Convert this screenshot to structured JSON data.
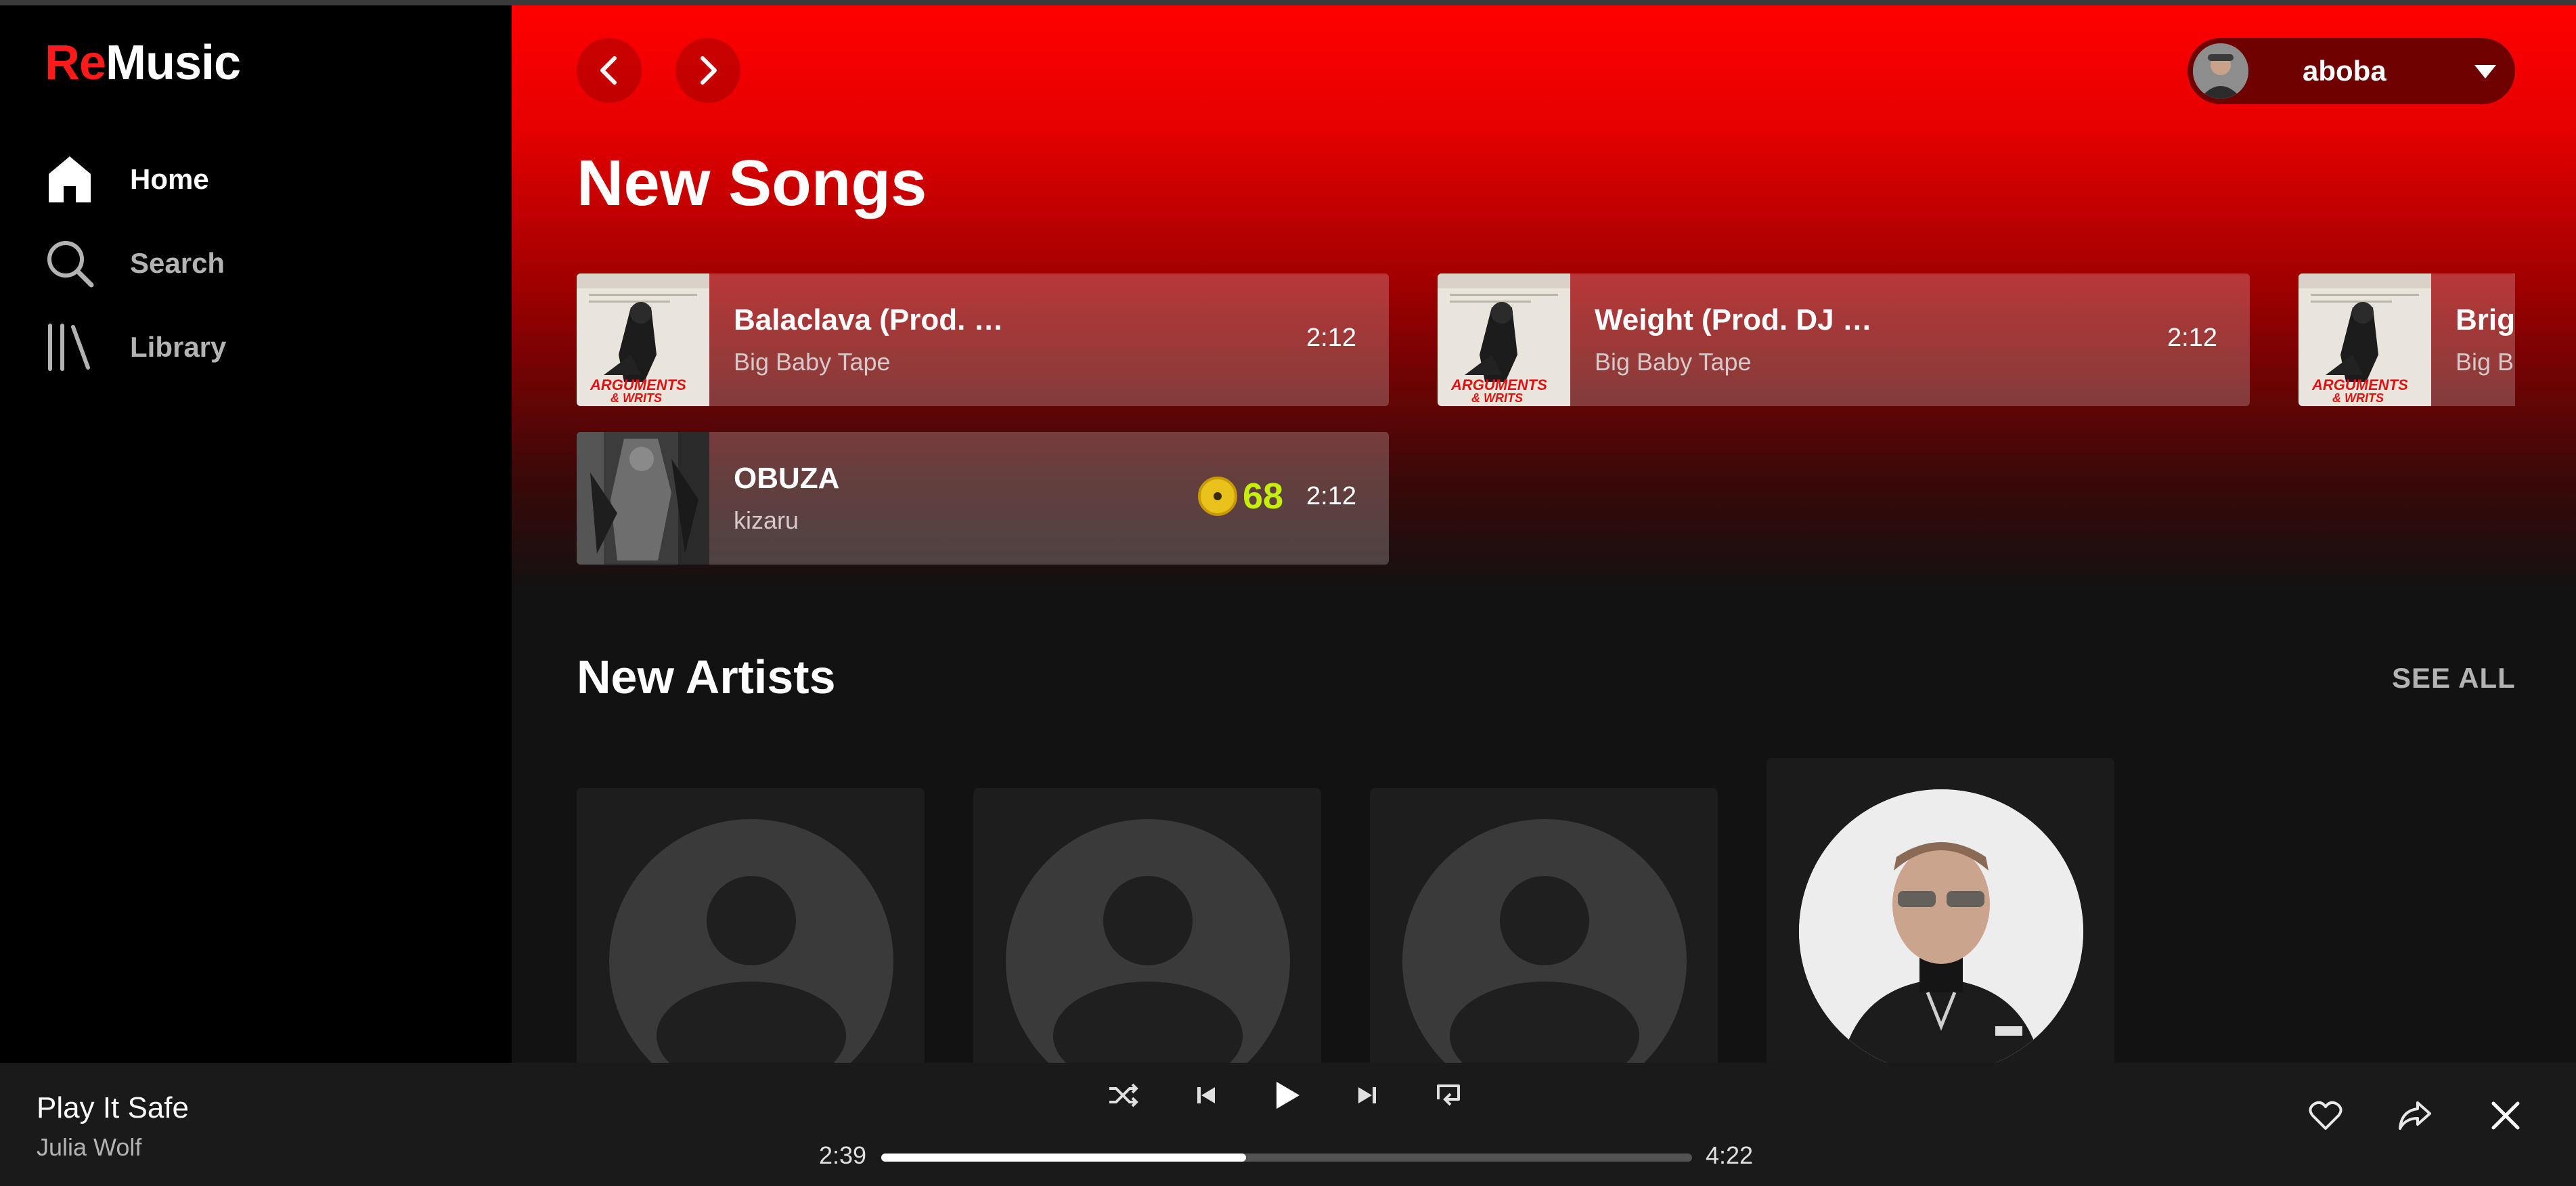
{
  "app": {
    "logo_re": "Re",
    "logo_music": "Music"
  },
  "sidebar": {
    "items": [
      {
        "label": "Home",
        "icon": "home-icon",
        "active": true
      },
      {
        "label": "Search",
        "icon": "search-icon",
        "active": false
      },
      {
        "label": "Library",
        "icon": "library-icon",
        "active": false
      }
    ]
  },
  "header": {
    "user_name": "aboba"
  },
  "new_songs": {
    "title": "New Songs",
    "songs": [
      {
        "title": "Balaclava (Prod. …",
        "artist": "Big Baby Tape",
        "duration": "2:12"
      },
      {
        "title": "Weight (Prod. DJ …",
        "artist": "Big Baby Tape",
        "duration": "2:12"
      },
      {
        "title": "Brig",
        "artist": "Big B",
        "duration": ""
      },
      {
        "title": "OBUZA",
        "artist": "kizaru",
        "duration": "2:12",
        "coins": "68"
      }
    ]
  },
  "new_artists": {
    "title": "New Artists",
    "see_all": "SEE ALL"
  },
  "player": {
    "title": "Play It Safe",
    "artist": "Julia Wolf",
    "elapsed": "2:39",
    "total": "4:22",
    "progress": 0.45
  },
  "colors": {
    "accent": "#ff0000",
    "coin_text": "#c6ef0a",
    "sidebar_bg": "#000000"
  }
}
